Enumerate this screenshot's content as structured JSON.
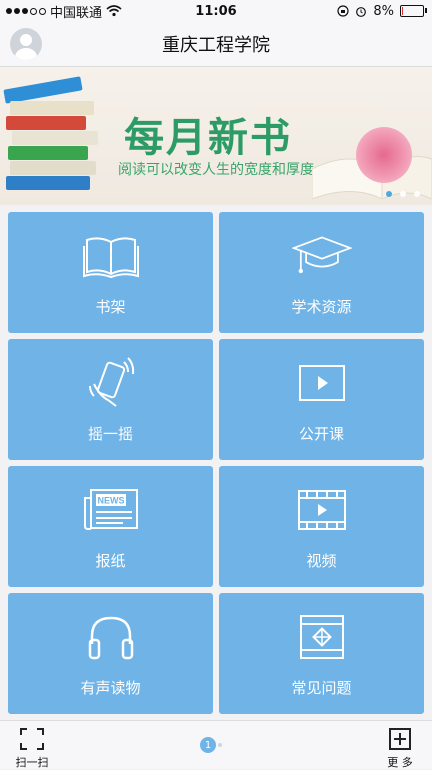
{
  "status_bar": {
    "carrier": "中国联通",
    "time": "11:06",
    "battery": "8%",
    "battery_level": 0.08
  },
  "navbar": {
    "title": "重庆工程学院"
  },
  "banner": {
    "title": "每月新书",
    "subtitle": "阅读可以改变人生的宽度和厚度",
    "slide_count": 3,
    "active_slide": 0
  },
  "tiles": [
    {
      "label": "书架",
      "icon": "book-icon"
    },
    {
      "label": "学术资源",
      "icon": "graduation-cap-icon"
    },
    {
      "label": "摇一摇",
      "icon": "shake-phone-icon"
    },
    {
      "label": "公开课",
      "icon": "play-screen-icon"
    },
    {
      "label": "报纸",
      "icon": "newspaper-icon",
      "icon_text": "NEWS"
    },
    {
      "label": "视频",
      "icon": "video-film-icon"
    },
    {
      "label": "有声读物",
      "icon": "headphones-icon"
    },
    {
      "label": "常见问题",
      "icon": "faq-icon"
    }
  ],
  "bottom_bar": {
    "scan_label": "扫一扫",
    "more_label": "更 多",
    "page_number": "1"
  },
  "colors": {
    "tile": "#6fb3e7",
    "banner_green": "#2d9b66",
    "pager_active": "#3aa3d9"
  }
}
